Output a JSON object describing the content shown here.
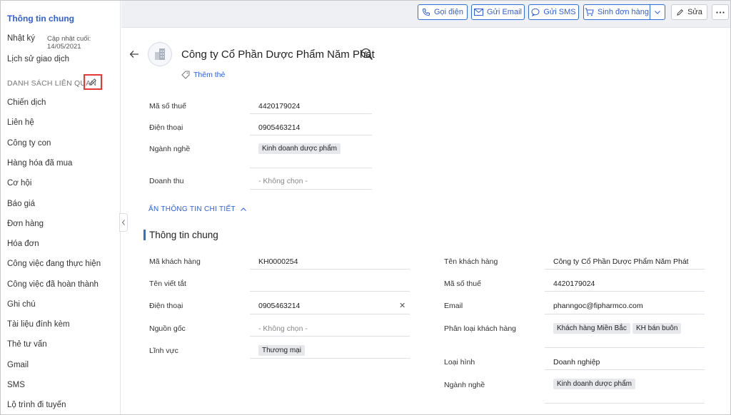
{
  "sidebar": {
    "title": "Thông tin chung",
    "log": "Nhật ký",
    "last_updated": "Cập nhật cuối: 14/05/2021",
    "history": "Lịch sử giao dịch",
    "related_header": "DANH SÁCH LIÊN QUAN",
    "items": [
      "Chiến dịch",
      "Liên hệ",
      "Công ty con",
      "Hàng hóa đã mua",
      "Cơ hội",
      "Báo giá",
      "Đơn hàng",
      "Hóa đơn",
      "Công việc đang thực hiện",
      "Công việc đã hoàn thành",
      "Ghi chú",
      "Tài liệu đính kèm",
      "Thẻ tư vấn",
      "Gmail",
      "SMS",
      "Lộ trình đi tuyến"
    ]
  },
  "toolbar": {
    "call": "Gọi điện",
    "email": "Gửi Email",
    "sms": "Gửi SMS",
    "create_order": "Sinh đơn hàng",
    "edit": "Sửa"
  },
  "header": {
    "company_name": "Công ty Cổ Phần Dược Phẩm Năm Phát",
    "add_tag": "Thêm thẻ"
  },
  "summary": {
    "tax_label": "Mã số thuế",
    "tax_value": "4420179024",
    "phone_label": "Điện thoại",
    "phone_value": "0905463214",
    "industry_label": "Ngành nghề",
    "industry_value": "Kinh doanh dược phẩm",
    "revenue_label": "Doanh thu",
    "revenue_value": "- Không chọn -"
  },
  "toggle_label": "ẨN THÔNG TIN CHI TIẾT",
  "general": {
    "section_title": "Thông tin chung",
    "customer_code_label": "Mã khách hàng",
    "customer_code_value": "KH0000254",
    "short_name_label": "Tên viết tắt",
    "phone_label": "Điện thoại",
    "phone_value": "0905463214",
    "source_label": "Nguồn gốc",
    "source_value": "- Không chọn -",
    "field_label": "Lĩnh vực",
    "field_value": "Thương mại",
    "customer_name_label": "Tên khách hàng",
    "customer_name_value": "Công ty Cổ Phần Dược Phẩm Năm Phát",
    "tax_label": "Mã số thuế",
    "tax_value": "4420179024",
    "email_label": "Email",
    "email_value": "phanngoc@fipharmco.com",
    "classification_label": "Phân loại khách hàng",
    "classification_values": [
      "Khách hàng Miền Bắc",
      "KH bán buôn"
    ],
    "type_label": "Loại hình",
    "type_value": "Doanh nghiệp",
    "industry_label": "Ngành nghề",
    "industry_value": "Kinh doanh dược phẩm"
  },
  "colors": {
    "accent": "#2f5fd6",
    "highlight": "#e53935",
    "toolbar_bg": "#eef0f4"
  }
}
